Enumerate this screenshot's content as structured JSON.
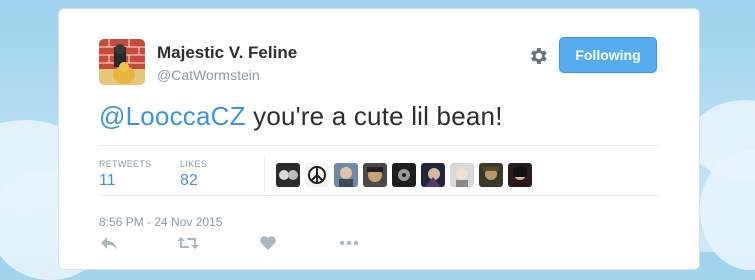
{
  "tweet": {
    "author_name": "Majestic V. Feline",
    "author_handle": "@CatWormstein",
    "follow_label": "Following",
    "mention": "@LooccaCZ",
    "text": " you're a cute lil bean!",
    "timestamp": "8:56 PM - 24 Nov 2015"
  },
  "stats": {
    "retweets_label": "RETWEETS",
    "retweets_count": "11",
    "likes_label": "LIKES",
    "likes_count": "82"
  },
  "likers": [
    {
      "icon": "liker-avatar"
    },
    {
      "icon": "liker-avatar"
    },
    {
      "icon": "liker-avatar"
    },
    {
      "icon": "liker-avatar"
    },
    {
      "icon": "liker-avatar"
    },
    {
      "icon": "liker-avatar"
    },
    {
      "icon": "liker-avatar"
    },
    {
      "icon": "liker-avatar"
    },
    {
      "icon": "liker-avatar"
    }
  ],
  "actions": [
    "reply-icon",
    "retweet-icon",
    "like-icon",
    "more-icon"
  ],
  "colors": {
    "accent": "#55acee",
    "link": "#3b94d9",
    "text": "#292f33",
    "muted": "#8899a6"
  }
}
